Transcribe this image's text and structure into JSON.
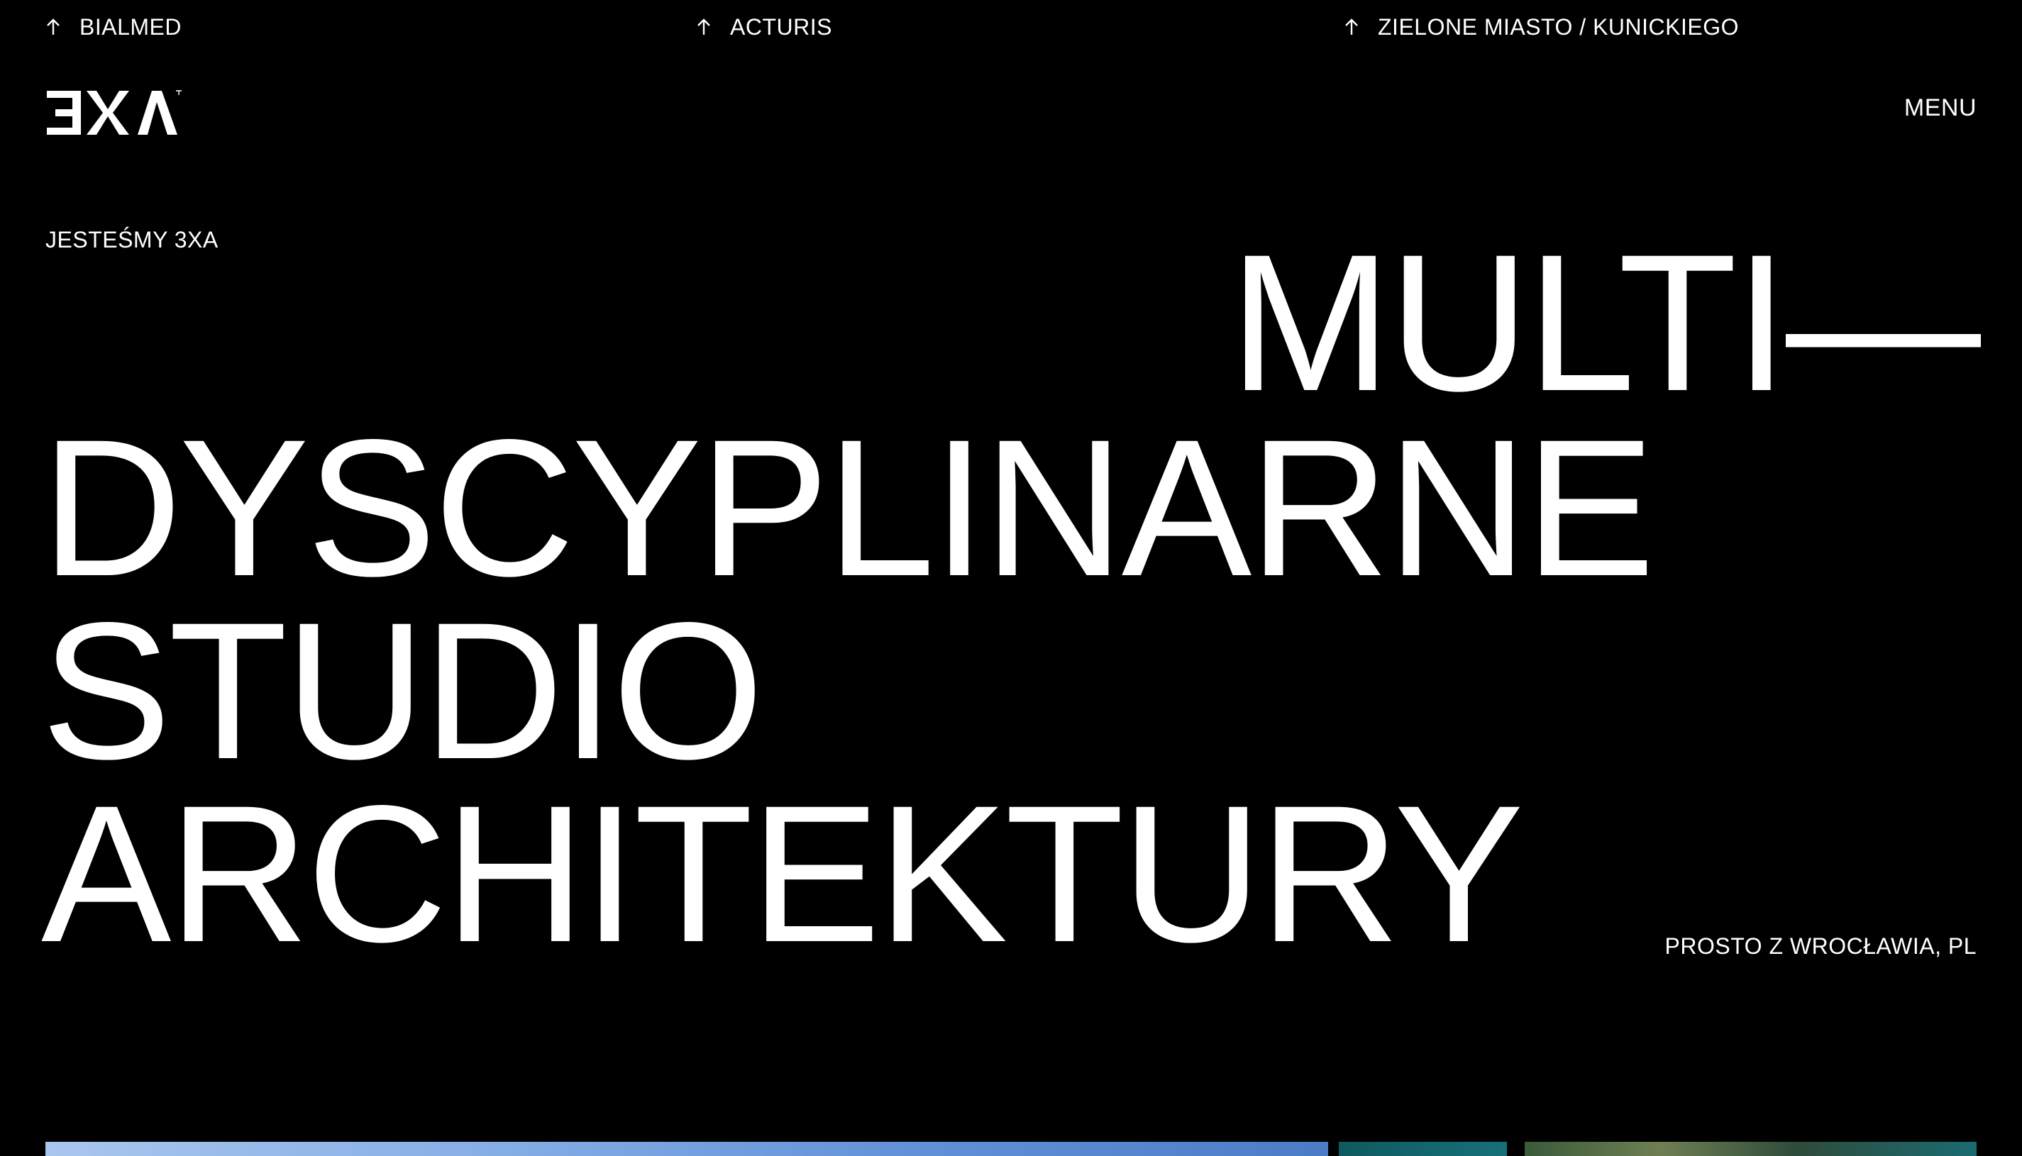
{
  "top_links": [
    {
      "label": "BIALMED",
      "icon": "arrow-up-icon"
    },
    {
      "label": "ACTURIS",
      "icon": "arrow-up-icon"
    },
    {
      "label": "ZIELONE MIASTO / KUNICKIEGO",
      "icon": "arrow-up-icon"
    }
  ],
  "header": {
    "logo_text": "3XA",
    "menu_label": "MENU"
  },
  "hero": {
    "intro": "JESTEŚMY 3XA",
    "lines": [
      "MULTI—",
      "DYSCYPLINARNE",
      "STUDIO",
      "ARCHITEKTURY"
    ],
    "location": "PROSTO Z WROCŁAWIA, PL"
  },
  "colors": {
    "background": "#000000",
    "text": "#ffffff"
  }
}
